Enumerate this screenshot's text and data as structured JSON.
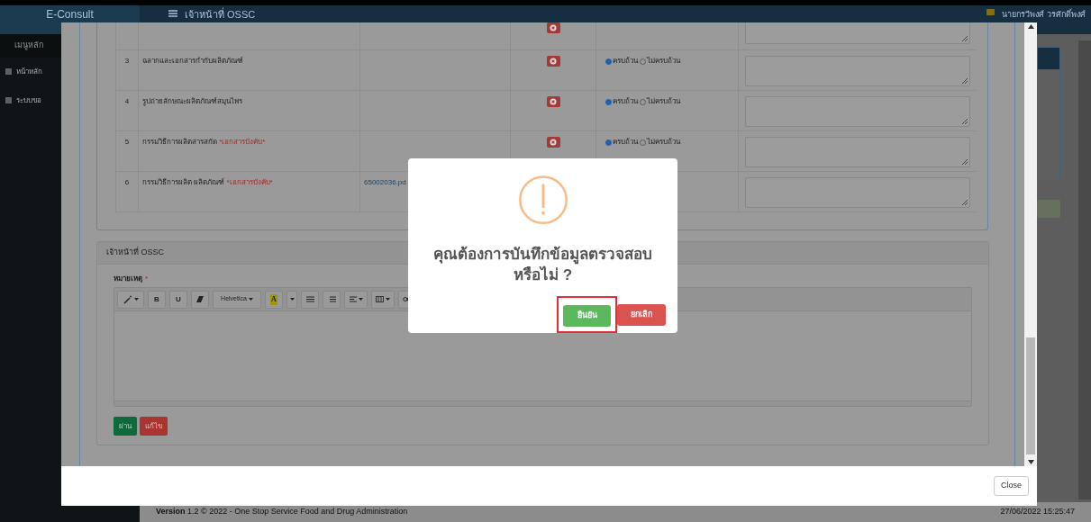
{
  "app": {
    "brand": "E-Consult",
    "page_title": "เจ้าหน้าที่ OSSC",
    "user_name": "นายกรวีพงศ์ วรศักดิ์พงศ์"
  },
  "sidebar": {
    "heading": "เมนูหลัก",
    "items": [
      "หน้าหลัก",
      "ระบบขอ"
    ]
  },
  "documents": [
    {
      "number": "3",
      "name": "ฉลากและเอกสารกำกับผลิตภัณฑ์",
      "options": [
        {
          "label": "ครบถ้วน",
          "selected": true
        },
        {
          "label": "ไม่ครบถ้วน",
          "selected": false
        }
      ]
    },
    {
      "number": "4",
      "name": "รูปถ่ายลักษณะผลิตภัณฑ์สมุนไพร",
      "options": [
        {
          "label": "ครบถ้วน",
          "selected": true
        },
        {
          "label": "ไม่ครบถ้วน",
          "selected": false
        }
      ]
    },
    {
      "number": "5",
      "name": "กรรมวิธีการผลิตสารสกัด",
      "required_note": "*เอกสารบังคับ*",
      "options": [
        {
          "label": "ครบถ้วน",
          "selected": true
        },
        {
          "label": "ไม่ครบถ้วน",
          "selected": false
        }
      ]
    },
    {
      "number": "6",
      "name": "กรรมวิธีการผลิต ผลิตภัณฑ์",
      "required_note": "*เอกสารบังคับ*",
      "file": "65002036.pd"
    }
  ],
  "review_panel": {
    "title": "เจ้าหน้าที่ OSSC",
    "field_label": "หมายเหตุ",
    "required_mark": "*",
    "toolbar": [
      "B",
      "U",
      "Helvetica",
      "A"
    ],
    "buttons": [
      "ผ่าน",
      "แก้ไข"
    ]
  },
  "modal": {
    "close_button": "Close"
  },
  "dialog": {
    "message": "คุณต้องการบันทึกข้อมูลตรวจสอบหรือไม่ ?",
    "confirm": {
      "label": "ยืนยัน",
      "highlighted": true
    },
    "cancel": "ยกเลิก"
  },
  "footer": {
    "version": "**Version** 1.2 © 2022 - One Stop Service Food and Drug Administration",
    "datetime": "27/06/2022 15:25:47"
  }
}
